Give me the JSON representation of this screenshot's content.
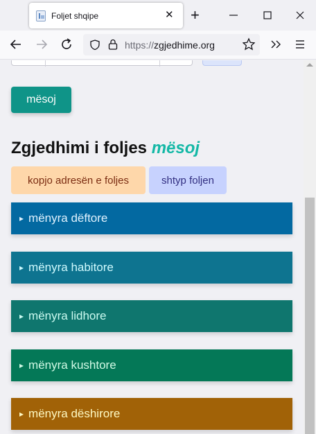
{
  "browser": {
    "tab_title": "Foljet shqipe",
    "tab_close": "✕",
    "new_tab": "+",
    "url_scheme": "https://",
    "url_host": "zgjedhime.org",
    "window_controls": [
      "minimize",
      "maximize",
      "close"
    ]
  },
  "page": {
    "learn_button": "mësoj",
    "heading_prefix": "Zgjedhimi i foljes",
    "heading_verb": "mësoj",
    "copy_button": "kopjo adresën e foljes",
    "print_button": "shtyp foljen",
    "moods": [
      {
        "label": "mënyra dëftore",
        "bg": "#0369a1",
        "fg": "#e0f2fe"
      },
      {
        "label": "mënyra habitore",
        "bg": "#0e7490",
        "fg": "#cffafe"
      },
      {
        "label": "mënyra lidhore",
        "bg": "#0f766e",
        "fg": "#ccfbf1"
      },
      {
        "label": "mënyra kushtore",
        "bg": "#047857",
        "fg": "#d1fae5"
      },
      {
        "label": "mënyra dëshirore",
        "bg": "#a16207",
        "fg": "#fef9c3"
      }
    ],
    "mood_marker": "▸"
  }
}
